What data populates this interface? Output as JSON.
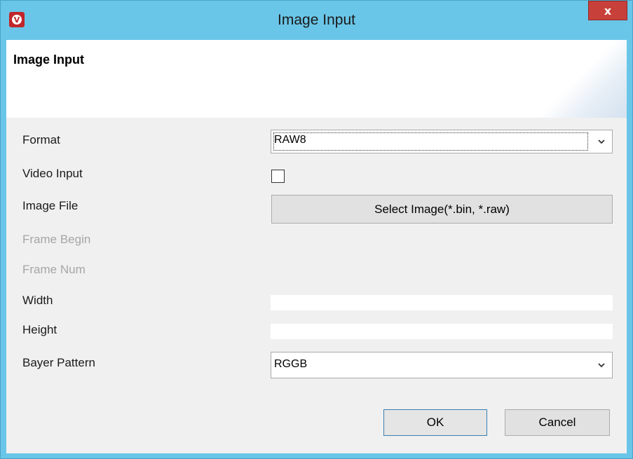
{
  "window": {
    "title": "Image Input",
    "close_label": "x"
  },
  "header": {
    "title": "Image Input"
  },
  "form": {
    "format": {
      "label": "Format",
      "value": "RAW8"
    },
    "video_input": {
      "label": "Video Input",
      "checked": false
    },
    "image_file": {
      "label": "Image File",
      "button_label": "Select Image(*.bin, *.raw)"
    },
    "frame_begin": {
      "label": "Frame Begin"
    },
    "frame_num": {
      "label": "Frame Num"
    },
    "width": {
      "label": "Width",
      "value": ""
    },
    "height": {
      "label": "Height",
      "value": ""
    },
    "bayer_pattern": {
      "label": "Bayer Pattern",
      "value": "RGGB"
    }
  },
  "buttons": {
    "ok": "OK",
    "cancel": "Cancel"
  },
  "colors": {
    "title_bar": "#6ac6e8",
    "close_button": "#c8403a",
    "app_icon": "#c0262a"
  },
  "icons": {
    "app": "vivado-logo-icon",
    "close": "close-icon",
    "dropdown": "chevron-down-icon"
  }
}
